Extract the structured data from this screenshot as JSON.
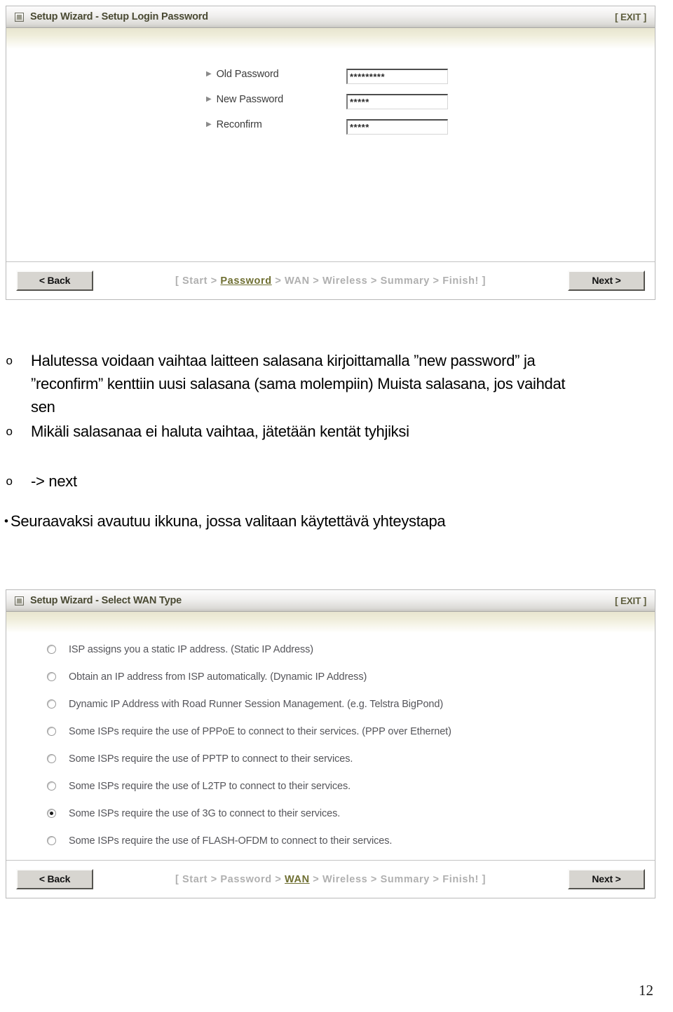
{
  "panels": [
    {
      "title": "Setup Wizard - Setup Login Password",
      "exit_label": "[ EXIT ]",
      "icon": "window-box-icon",
      "form_rows": [
        {
          "label": "Old Password",
          "value": "*********",
          "marker": "arrow-right-icon"
        },
        {
          "label": "New Password",
          "value": "*****",
          "marker": "arrow-right-icon"
        },
        {
          "label": "Reconfirm",
          "value": "*****",
          "marker": "arrow-right-icon"
        }
      ],
      "footer": {
        "back_label": "< Back",
        "next_label": "Next >",
        "breadcrumb_prefix": "[ Start > ",
        "breadcrumb_active": "Password",
        "breadcrumb_suffix": " > WAN > Wireless > Summary > Finish! ]"
      }
    },
    {
      "title": "Setup Wizard - Select WAN Type",
      "exit_label": "[ EXIT ]",
      "icon": "window-box-icon",
      "options": [
        {
          "label": "ISP assigns you a static IP address. (Static IP Address)",
          "selected": false
        },
        {
          "label": "Obtain an IP address from ISP automatically. (Dynamic IP Address)",
          "selected": false
        },
        {
          "label": "Dynamic IP Address with Road Runner Session Management. (e.g. Telstra BigPond)",
          "selected": false
        },
        {
          "label": "Some ISPs require the use of PPPoE to connect to their services. (PPP over Ethernet)",
          "selected": false
        },
        {
          "label": "Some ISPs require the use of PPTP to connect to their services.",
          "selected": false
        },
        {
          "label": "Some ISPs require the use of L2TP to connect to their services.",
          "selected": false
        },
        {
          "label": "Some ISPs require the use of 3G to connect to their services.",
          "selected": true
        },
        {
          "label": "Some ISPs require the use of FLASH-OFDM to connect to their services.",
          "selected": false
        }
      ],
      "footer": {
        "back_label": "< Back",
        "next_label": "Next >",
        "breadcrumb_prefix": "[ Start > Password > ",
        "breadcrumb_active": "WAN",
        "breadcrumb_suffix": " > Wireless > Summary > Finish! ]"
      }
    }
  ],
  "notes": {
    "items": [
      {
        "bullet": "o",
        "text": "Halutessa voidaan vaihtaa laitteen salasana kirjoittamalla ”new password” ja ”reconfirm” kenttiin uusi salasana (sama molempiin) Muista salasana, jos vaihdat sen"
      },
      {
        "bullet": "o",
        "text": "Mikäli salasanaa ei haluta vaihtaa, jätetään kentät tyhjiksi"
      },
      {
        "bullet": "o",
        "text": "-> next"
      }
    ],
    "final": {
      "bullet": "•",
      "text": "Seuraavaksi avautuu ikkuna, jossa valitaan käytettävä yhteystapa"
    }
  },
  "page_number": "12",
  "colors": {
    "accent": "#6f6f32",
    "title_text": "#4a4a33",
    "breadcrumb_inactive": "#b0b0b0"
  }
}
